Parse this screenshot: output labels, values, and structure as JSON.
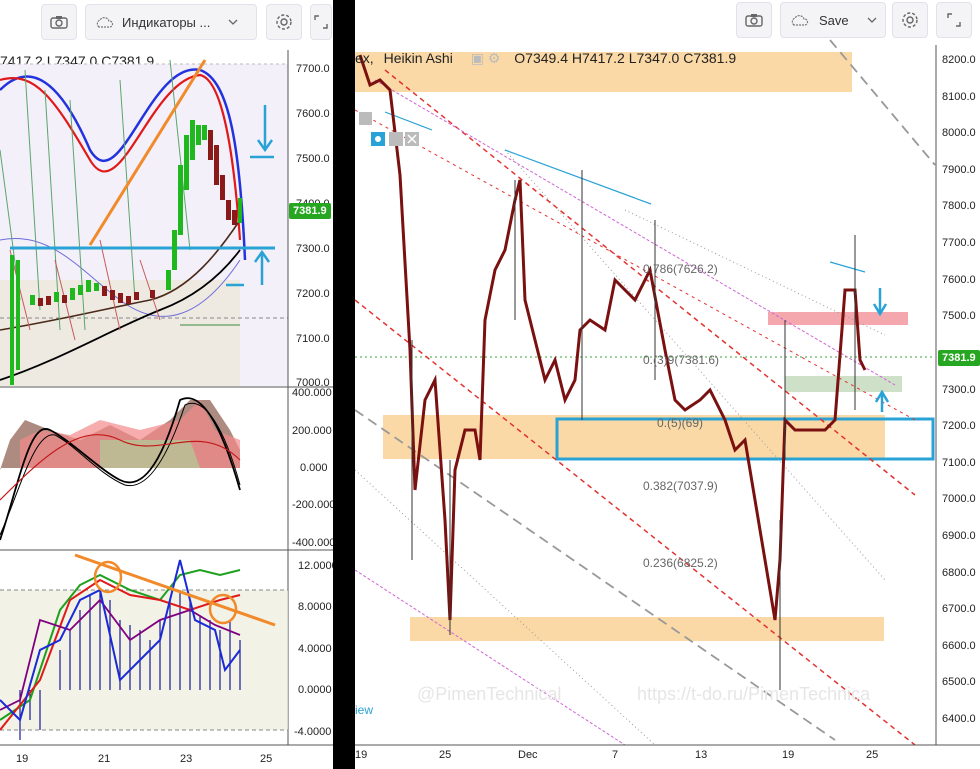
{
  "left_panel": {
    "toolbar": {
      "indicators_label": "Индикаторы ...",
      "icons": [
        "camera-icon",
        "cloud-icon",
        "chevron-down-icon",
        "gear-icon",
        "fullscreen-icon"
      ]
    },
    "ohlc_text": "7417.2   L7347.0   C7381.9",
    "price_axis": [
      "7700.0",
      "7600.0",
      "7500.0",
      "7400.0",
      "7300.0",
      "7200.0",
      "7100.0",
      "7000.0"
    ],
    "last_price": "7381.9",
    "osc1_axis": [
      "400.000",
      "200.000",
      "0.000",
      "-200.000",
      "-400.000"
    ],
    "osc2_axis": [
      "12.0000",
      "8.0000",
      "4.0000",
      "0.0000",
      "-4.0000"
    ],
    "time_axis": [
      "19",
      "21",
      "23",
      "25"
    ]
  },
  "right_panel": {
    "toolbar": {
      "save_label": "Save",
      "icons": [
        "camera-icon",
        "cloud-icon",
        "chevron-down-icon",
        "gear-icon",
        "fullscreen-icon"
      ]
    },
    "legend": {
      "symbol": "ex,",
      "chart_style": "Heikin Ashi",
      "ohlc": "O7349.4   H7417.2   L7347.0   C7381.9"
    },
    "price_axis": [
      "8200.0",
      "8100.0",
      "8000.0",
      "7900.0",
      "7800.0",
      "7700.0",
      "7600.0",
      "7500.0",
      "7400.0",
      "7300.0",
      "7200.0",
      "7100.0",
      "7000.0",
      "6900.0",
      "6800.0",
      "6700.0",
      "6600.0",
      "6500.0",
      "6400.0"
    ],
    "last_price": "7381.9",
    "fib_labels": [
      "0.786(7626.2)",
      "0.(3)9(7381.6)",
      "0.(5)(69)",
      "0.382(7037.9)",
      "0.236(6825.2)"
    ],
    "time_axis": [
      "19",
      "25",
      "Dec",
      "7",
      "13",
      "19",
      "25"
    ],
    "watermark_left": "@PimenTechnical",
    "watermark_right": "https://t-do.ru/PimenTechnica",
    "view_link": "iew"
  },
  "colors": {
    "candle_up": "#2e7d32",
    "candle_down": "#7b1010",
    "price_tag_bg": "#26a621",
    "zone_orange": "#fbd9a6",
    "zone_red": "#f4a8ae",
    "zone_green": "#cfe0c8",
    "box_blue": "#29a3d6",
    "fib_red": "#e3322f",
    "fib_magenta": "#d063d6"
  }
}
